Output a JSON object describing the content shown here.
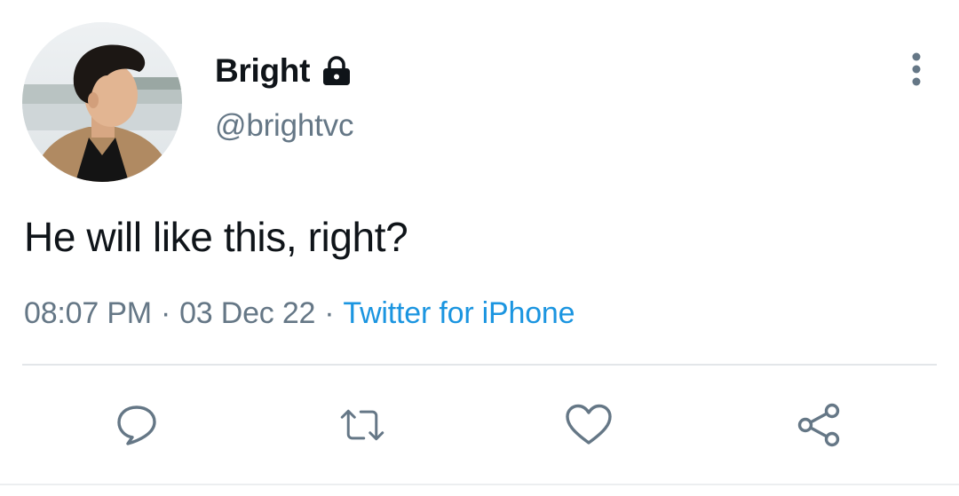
{
  "user": {
    "display_name": "Bright",
    "handle": "@brightvc",
    "protected_icon": "lock-icon",
    "avatar_icon": "profile-photo"
  },
  "tweet": {
    "text": "He will like this, right?",
    "time": "08:07 PM",
    "separator": "·",
    "date": "03 Dec 22",
    "source": "Twitter for iPhone"
  },
  "actions": {
    "reply_icon": "reply-icon",
    "retweet_icon": "retweet-icon",
    "like_icon": "heart-icon",
    "share_icon": "share-icon",
    "more_icon": "more-vertical-icon"
  },
  "colors": {
    "text_primary": "#0f1419",
    "text_secondary": "#657786",
    "link": "#1b95e0",
    "divider": "#e3e6e9"
  }
}
